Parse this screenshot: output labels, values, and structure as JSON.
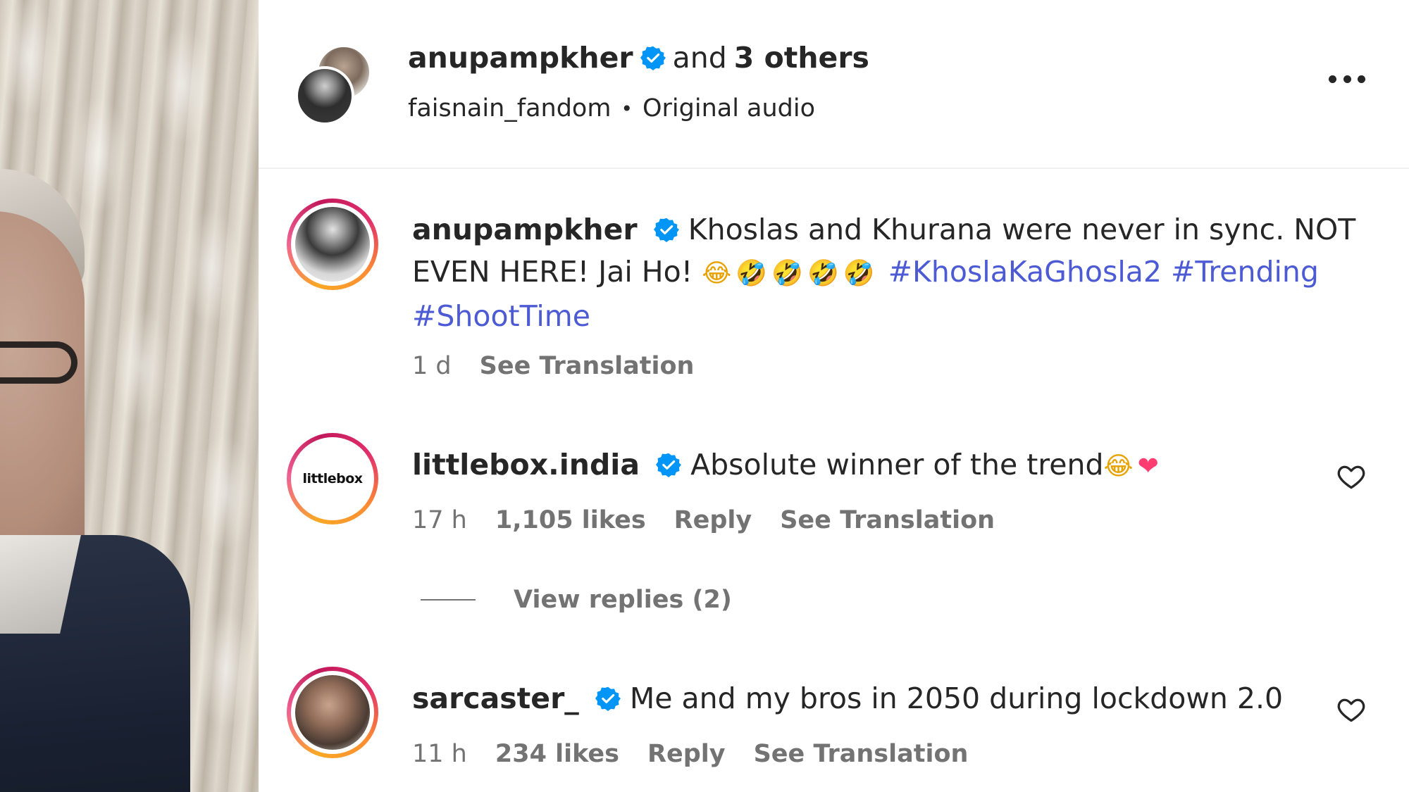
{
  "header": {
    "username": "anupampkher",
    "and_text": "and",
    "others_text": "3 others",
    "audio_author": "faisnain_fandom",
    "separator": "•",
    "audio_label": "Original audio"
  },
  "comments": [
    {
      "username": "anupampkher",
      "verified": true,
      "text": "Khoslas and Khurana were never in sync. NOT EVEN HERE! Jai Ho!",
      "emojis": [
        "😂",
        "🤣",
        "🤣",
        "🤣",
        "🤣"
      ],
      "hashtags": [
        "#KhoslaKaGhosla2",
        "#Trending",
        "#ShootTime"
      ],
      "time": "1 d",
      "see_translation": "See Translation"
    },
    {
      "username": "littlebox.india",
      "verified": true,
      "avatar_text": "littlebox",
      "text": "Absolute winner of the trend",
      "emojis": [
        "😂",
        "❤"
      ],
      "time": "17 h",
      "likes": "1,105 likes",
      "reply": "Reply",
      "see_translation": "See Translation"
    },
    {
      "username": "sarcaster_",
      "verified": true,
      "text": "Me and my bros in 2050 during lockdown 2.0",
      "time": "11 h",
      "likes": "234 likes",
      "reply": "Reply",
      "see_translation": "See Translation"
    }
  ],
  "view_replies": "View replies (2)",
  "colors": {
    "hashtag": "#4c5bd4",
    "verified": "#0095f6",
    "muted": "#737373",
    "text": "#262626"
  },
  "icons": {
    "more": "more-options-icon",
    "verified": "verified-badge-icon",
    "like": "heart-outline-icon"
  }
}
